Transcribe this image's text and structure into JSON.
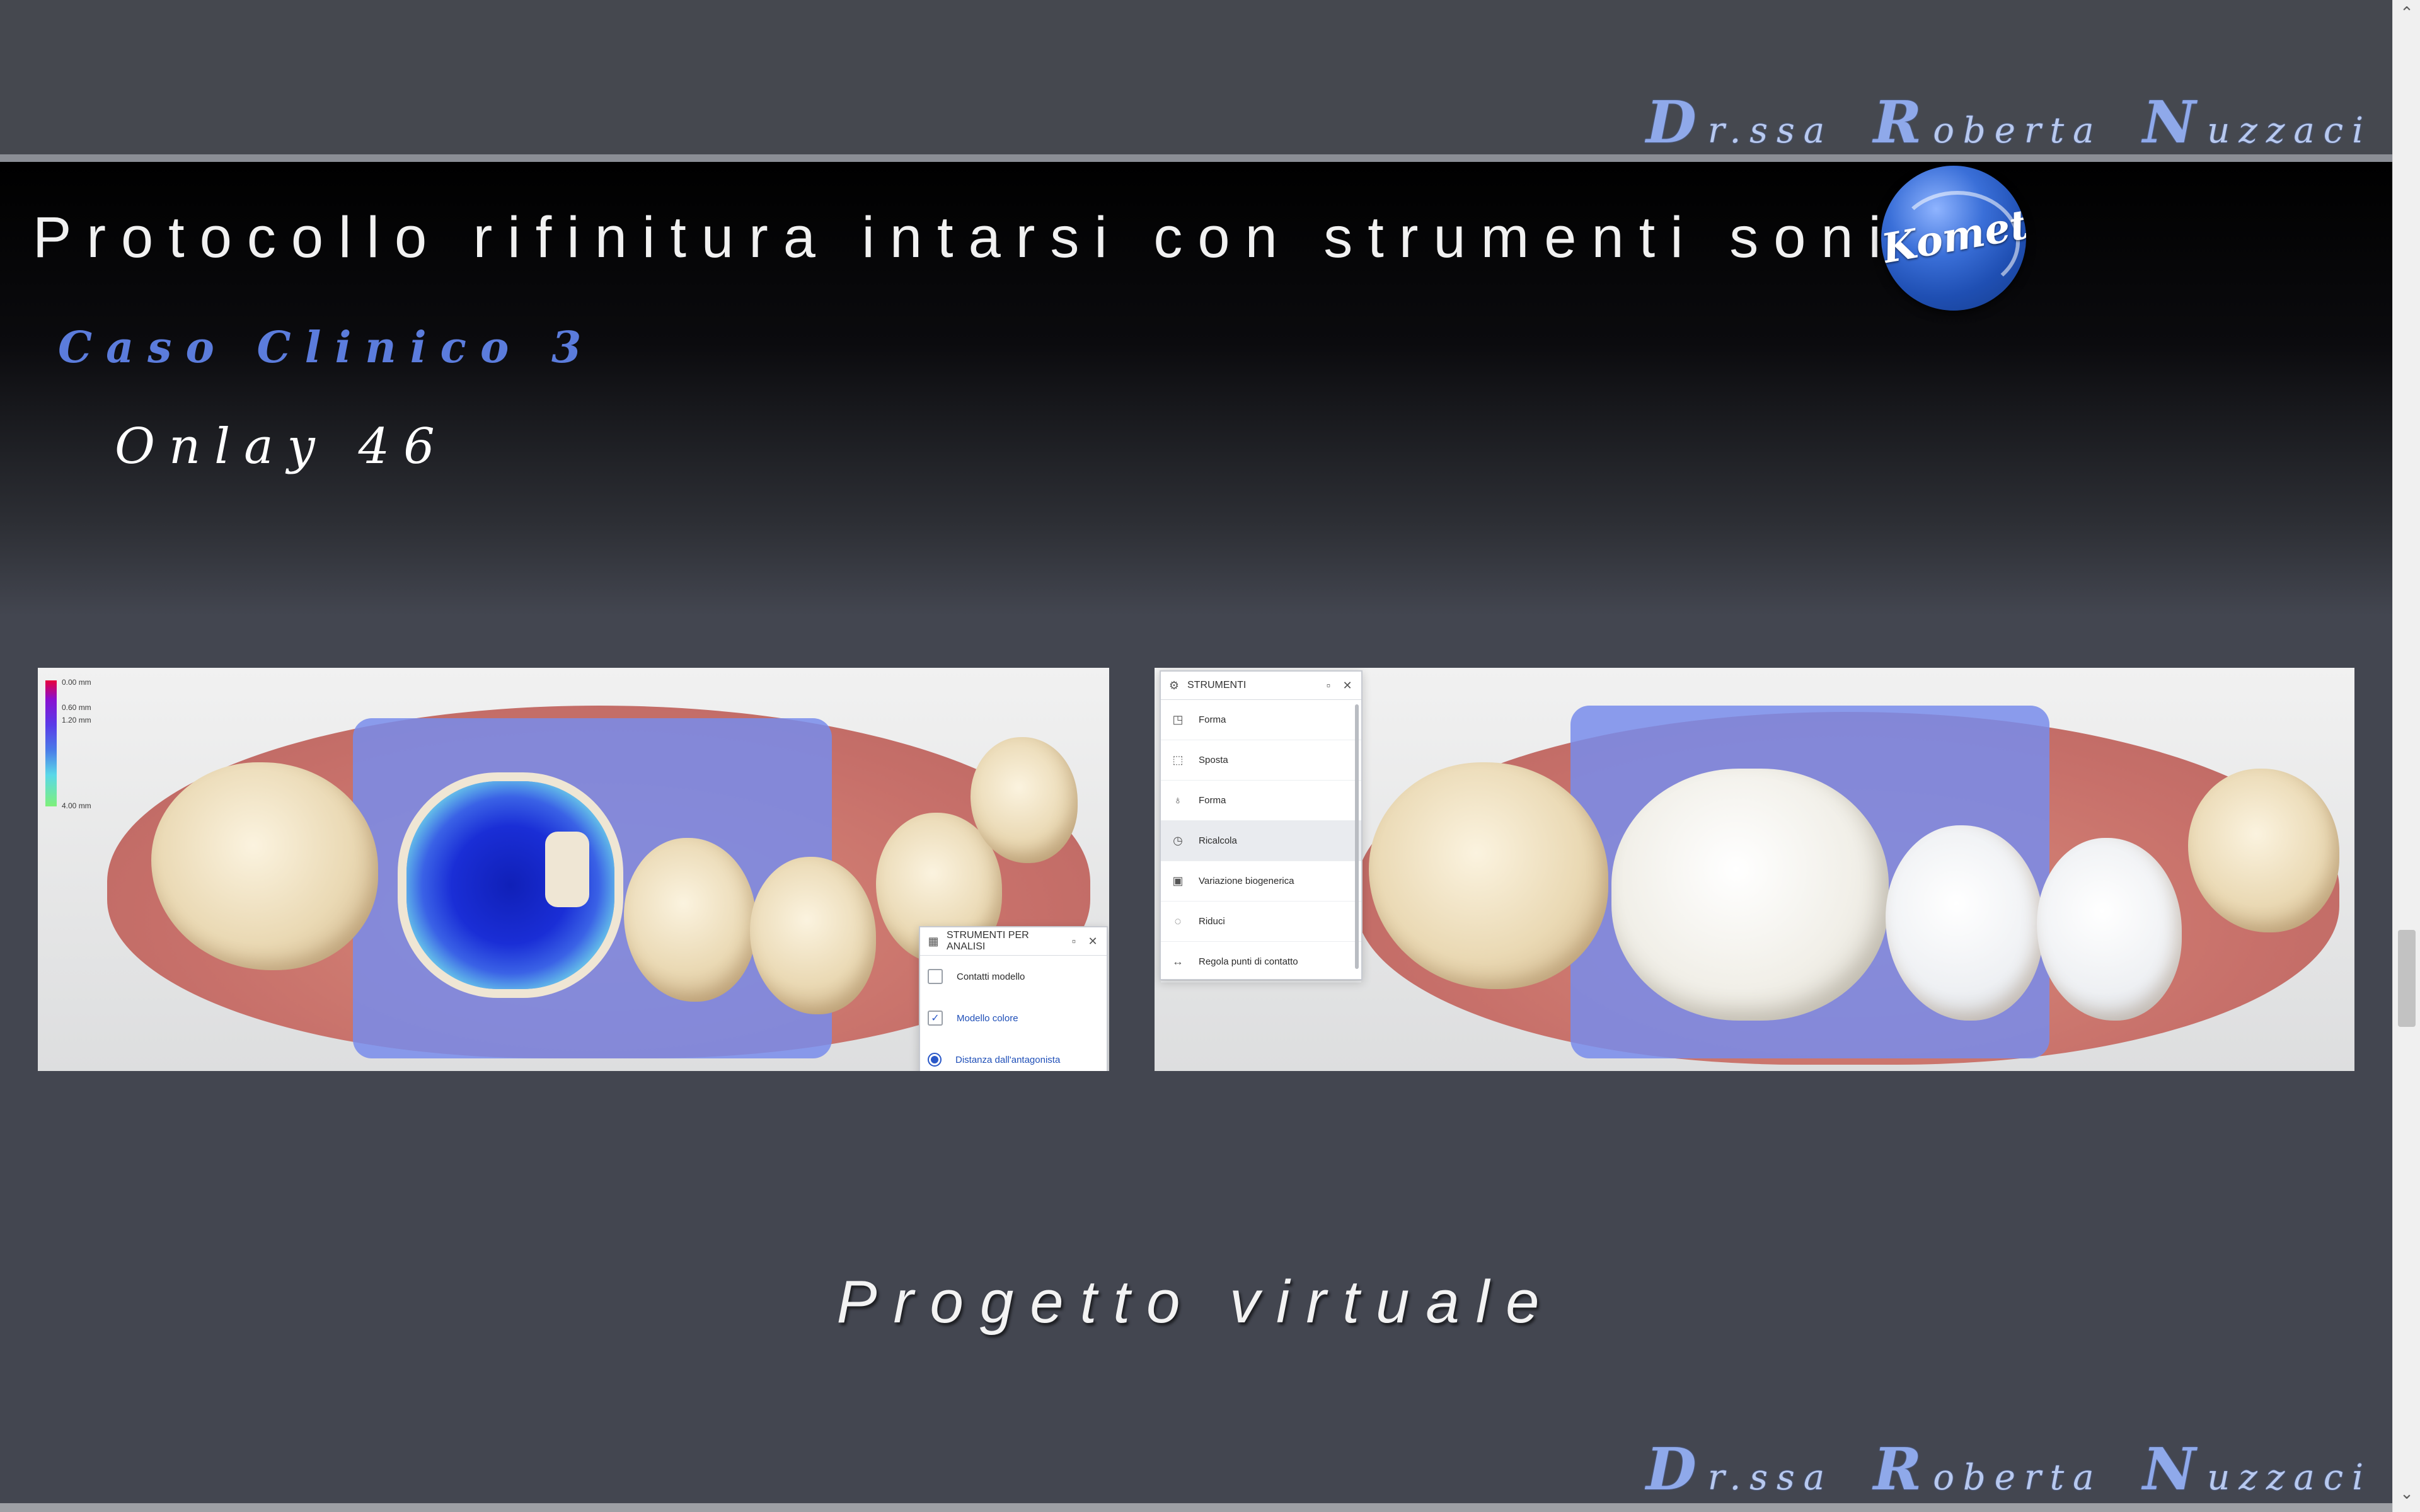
{
  "signature": {
    "initial_1": "D",
    "rest_1": "r.ssa",
    "initial_2": "R",
    "rest_2": "oberta",
    "initial_3": "N",
    "rest_3": "uzzaci"
  },
  "header": {
    "title": "Protocollo rifinitura intarsi con strumenti sonici",
    "logo_text": "Komet",
    "case": "Caso Clinico 3",
    "subtitle": "Onlay 46"
  },
  "left_image": {
    "scale_labels": [
      "0.00 mm",
      "0.60 mm",
      "1.20 mm",
      "4.00 mm"
    ],
    "analysis_panel": {
      "title": "STRUMENTI PER ANALISI",
      "rows": [
        {
          "label": "Contatti modello",
          "checked": false
        },
        {
          "label": "Modello colore",
          "checked": true
        },
        {
          "label": "Distanza dall'antagonista",
          "radio": true
        }
      ]
    }
  },
  "right_image": {
    "tools_panel": {
      "title": "STRUMENTI",
      "items": [
        "Forma",
        "Sposta",
        "Forma",
        "Ricalcola",
        "Variazione biogenerica",
        "Riduci",
        "Regola punti di contatto"
      ],
      "selected_index": 3
    }
  },
  "caption": "Progetto virtuale",
  "colors": {
    "accent_blue": "#5b7cdc",
    "signature": "#8fa9ea",
    "background": "#434650"
  }
}
